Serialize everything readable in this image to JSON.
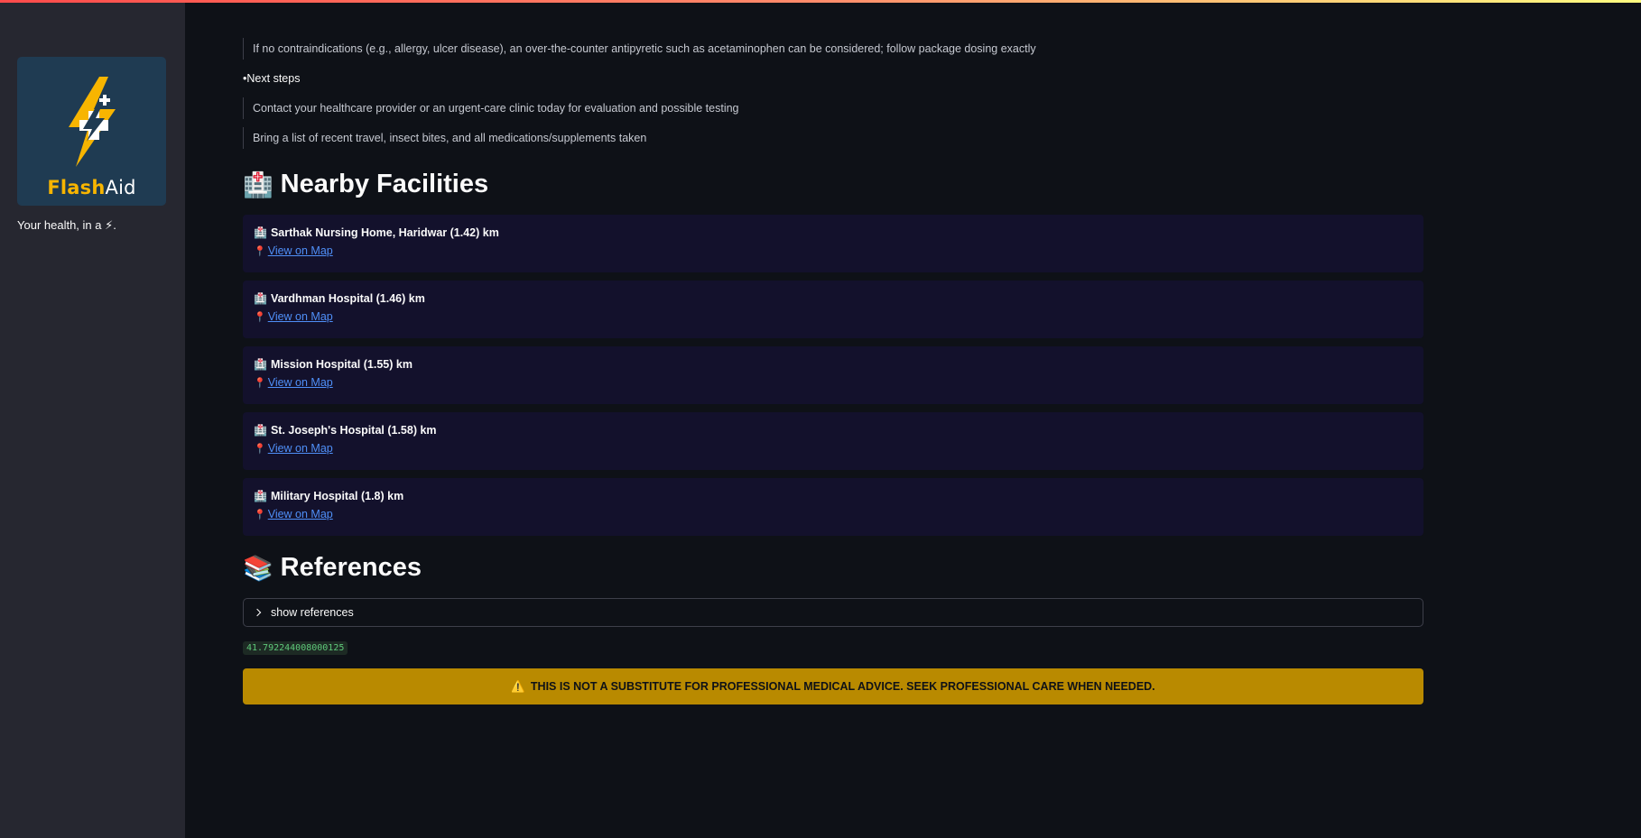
{
  "sidebar": {
    "logo": {
      "word_flash": "Flash",
      "word_aid": "Aid"
    },
    "tagline": "Your health, in a ⚡."
  },
  "advice": {
    "otc_line": "If no contraindications (e.g., allergy, ulcer disease), an over-the-counter antipyretic such as acetaminophen can be considered; follow package dosing exactly",
    "next_steps_heading": "Next steps",
    "next_steps_bullet": "•",
    "next_steps": [
      "Contact your healthcare provider or an urgent-care clinic today for evaluation and possible testing",
      "Bring a list of recent travel, insect bites, and all medications/supplements taken"
    ]
  },
  "facilities": {
    "heading_icon": "🏥",
    "heading": "Nearby Facilities",
    "item_icon": "🏥",
    "pin_icon": "📍",
    "map_link_label": "View on Map",
    "items": [
      {
        "name": "Sarthak Nursing Home, Haridwar (1.42) km"
      },
      {
        "name": "Vardhman Hospital (1.46) km"
      },
      {
        "name": "Mission Hospital (1.55) km"
      },
      {
        "name": "St. Joseph's Hospital (1.58) km"
      },
      {
        "name": "Military Hospital (1.8) km"
      }
    ]
  },
  "references": {
    "heading_icon": "📚",
    "heading": "References",
    "expander_label": "show references"
  },
  "timing_value": "41.792244008000125",
  "disclaimer": {
    "icon": "⚠️",
    "text": "THIS IS NOT A SUBSTITUTE FOR PROFESSIONAL MEDICAL ADVICE. SEEK PROFESSIONAL CARE WHEN NEEDED."
  },
  "colors": {
    "app_bg": "#0e1117",
    "sidebar_bg": "#262730",
    "card_bg": "#13112c",
    "link": "#4f8ff7",
    "warning_bg": "#b98a00",
    "brand_yellow": "#f7b500"
  }
}
